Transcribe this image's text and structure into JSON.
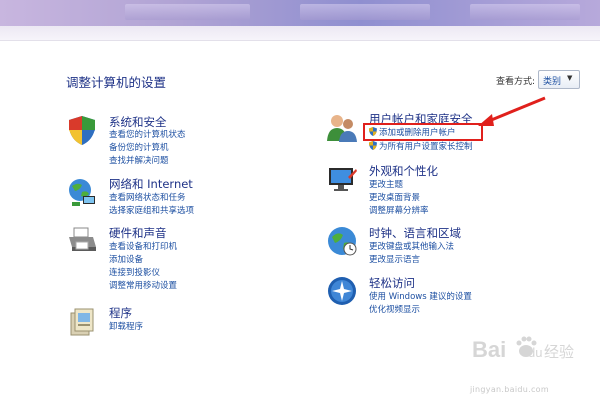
{
  "page_title": "调整计算机的设置",
  "view_by": {
    "label": "查看方式:",
    "value": "类别"
  },
  "categories": [
    {
      "title": "系统和安全",
      "icon": "shield-icon",
      "links": [
        "查看您的计算机状态",
        "备份您的计算机",
        "查找并解决问题"
      ]
    },
    {
      "title": "网络和 Internet",
      "icon": "globe-network-icon",
      "links": [
        "查看网络状态和任务",
        "选择家庭组和共享选项"
      ]
    },
    {
      "title": "硬件和声音",
      "icon": "printer-icon",
      "links": [
        "查看设备和打印机",
        "添加设备",
        "连接到投影仪",
        "调整常用移动设置"
      ]
    },
    {
      "title": "程序",
      "icon": "programs-icon",
      "links": [
        "卸载程序"
      ]
    },
    {
      "title": "用户帐户和家庭安全",
      "icon": "users-icon",
      "links": [
        "添加或删除用户帐户",
        "为所有用户设置家长控制"
      ]
    },
    {
      "title": "外观和个性化",
      "icon": "monitor-paint-icon",
      "links": [
        "更改主题",
        "更改桌面背景",
        "调整屏幕分辨率"
      ]
    },
    {
      "title": "时钟、语言和区域",
      "icon": "globe-clock-icon",
      "links": [
        "更改键盘或其他输入法",
        "更改显示语言"
      ]
    },
    {
      "title": "轻松访问",
      "icon": "ease-of-access-icon",
      "links": [
        "使用 Windows 建议的设置",
        "优化视频显示"
      ]
    }
  ],
  "watermark": {
    "brand": "Bai",
    "brand2": "du",
    "text": "经验",
    "url": "jingyan.baidu.com"
  },
  "colors": {
    "highlight": "#e0201c",
    "link": "#1e50a2",
    "heading": "#1e3287"
  }
}
